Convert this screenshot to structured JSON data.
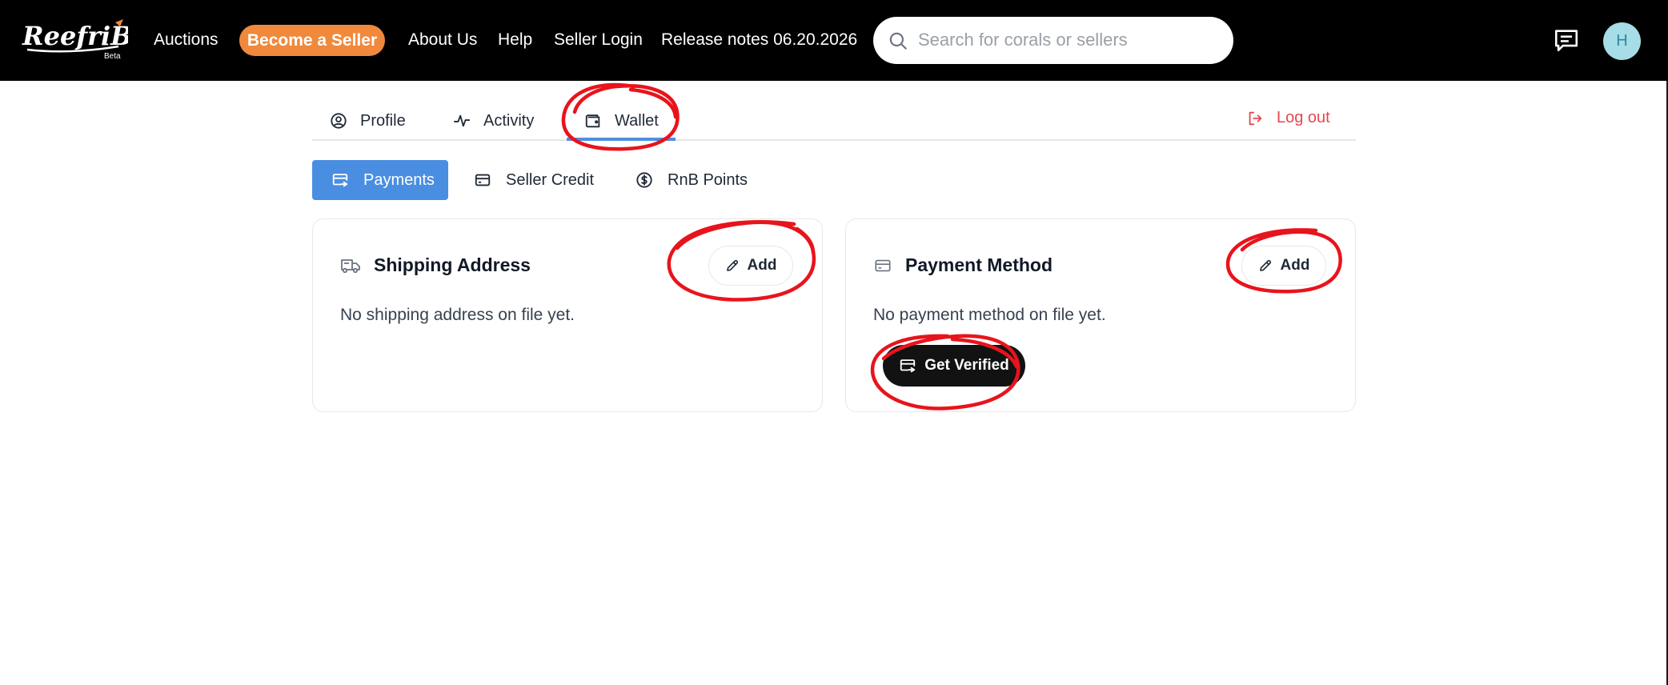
{
  "brand": {
    "logo_text": "ReefriBid",
    "logo_badge": "Beta"
  },
  "topnav": {
    "auctions": "Auctions",
    "become_seller": "Become a Seller",
    "about": "About Us",
    "help": "Help",
    "seller_login": "Seller Login",
    "release_notes": "Release notes 06.20.2026",
    "search_placeholder": "Search for corals or sellers",
    "avatar_initial": "H"
  },
  "account_tabs": {
    "profile": "Profile",
    "activity": "Activity",
    "wallet": "Wallet",
    "active": "wallet",
    "logout": "Log out"
  },
  "wallet_tabs": {
    "payments": "Payments",
    "seller_credit": "Seller Credit",
    "rnb_points": "RnB Points",
    "active": "payments"
  },
  "shipping": {
    "title": "Shipping Address",
    "add_label": "Add",
    "empty": "No shipping address on file yet."
  },
  "payment": {
    "title": "Payment Method",
    "add_label": "Add",
    "empty": "No payment method on file yet.",
    "verify_label": "Get Verified"
  },
  "colors": {
    "topbar": "#000000",
    "seller_button": "#f0893c",
    "active_tab": "#4a8ee2",
    "logout": "#e5484d",
    "annotation": "#e8141c"
  }
}
